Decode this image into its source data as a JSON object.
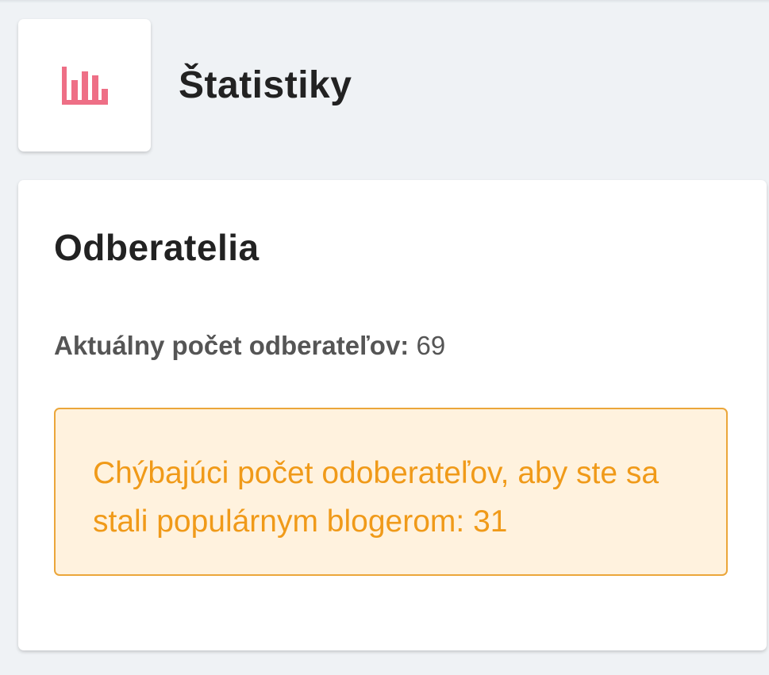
{
  "header": {
    "title": "Štatistiky",
    "icon": "bar-chart-icon",
    "icon_color": "#ee6f86"
  },
  "subscribers_card": {
    "title": "Odberatelia",
    "count_label": "Aktuálny počet odberateľov:",
    "count_value": "69",
    "alert_text": "Chýbajúci počet odoberateľov, aby ste sa stali populárnym blogerom: 31"
  },
  "colors": {
    "background": "#eff2f5",
    "alert_text": "#f09a19",
    "alert_border": "#eba63a",
    "alert_background": "#fff2de"
  }
}
